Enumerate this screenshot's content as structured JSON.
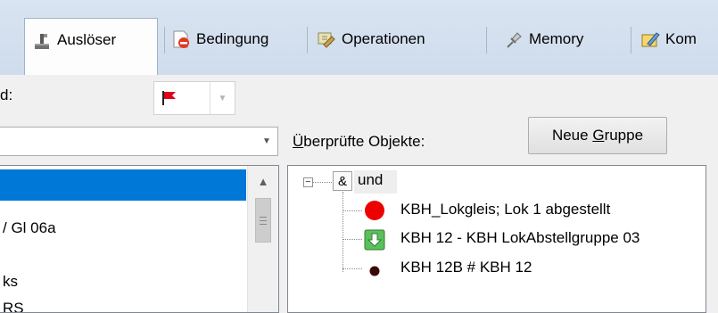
{
  "tabs": [
    {
      "label": "Auslöser",
      "icon": "trigger-icon",
      "active": true
    },
    {
      "label": "Bedingung",
      "icon": "condition-icon",
      "active": false
    },
    {
      "label": "Operationen",
      "icon": "operations-icon",
      "active": false
    },
    {
      "label": "Memory",
      "icon": "pin-icon",
      "active": false
    },
    {
      "label": "Kom",
      "icon": "comment-icon",
      "active": false
    }
  ],
  "form": {
    "left_label": "d:",
    "flag_icon": "red-flag-icon",
    "checked_label": "Überprüfte Objekte:",
    "checked_label_accesskey": "Ü",
    "new_group_prefix": "Neue ",
    "new_group_accesskey": "G",
    "new_group_suffix": "ruppe"
  },
  "left_list": {
    "items": [
      "",
      "/ Gl 06a",
      "",
      "ks",
      "RS"
    ]
  },
  "tree": {
    "root": {
      "operator": "&",
      "label": "und",
      "expander": "−"
    },
    "children": [
      {
        "label": "KBH_Lokgleis; Lok 1 abgestellt",
        "icon": "red-circle-icon",
        "color": "#ee0000"
      },
      {
        "label": "KBH 12 - KBH LokAbstellgruppe 03",
        "icon": "green-down-arrow-icon",
        "color": "#4caf50"
      },
      {
        "label": "KBH 12B # KBH 12",
        "icon": "dark-dot-icon",
        "color": "#3a0a0a"
      }
    ]
  },
  "colors": {
    "tab_strip": "#d9e4f1",
    "selection": "#0078d7",
    "flag": "#e0001b"
  }
}
